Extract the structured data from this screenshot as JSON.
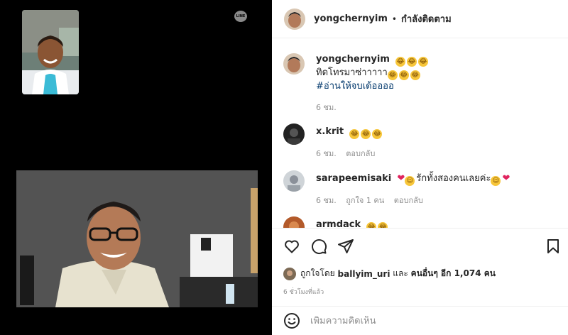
{
  "media": {
    "watermark": "LINE"
  },
  "header": {
    "username": "yongchernyim",
    "separator": "•",
    "follow_label": "กำลังติดตาม"
  },
  "caption": {
    "username": "yongchernyim",
    "line1": "ทิดโทรมาซ่าาาาา",
    "hashtag": "#อ่านให้จบเด้ออออ",
    "time": "6 ชม."
  },
  "comments": [
    {
      "username": "x.krit",
      "time": "6 ชม.",
      "reply": "ตอบกลับ"
    },
    {
      "username": "sarapeemisaki",
      "text": "รักทั้งสองคนเลยค่ะ",
      "time": "6 ชม.",
      "likes": "ถูกใจ 1 คน",
      "reply": "ตอบกลับ"
    },
    {
      "username": "armdack"
    }
  ],
  "actions": {
    "liked_by_prefix": "ถูกใจโดย",
    "liked_by_user": "ballyim_uri",
    "liked_by_mid": "และ",
    "liked_by_rest": "คนอื่นๆ อีก 1,074 คน",
    "time_ago": "6 ชั่วโมงที่แล้ว"
  },
  "comment_box": {
    "placeholder": "เพิ่มความคิดเห็น"
  },
  "colors": {
    "media_bg": "#000000",
    "link": "#00376b",
    "muted": "#8e8e8e"
  }
}
